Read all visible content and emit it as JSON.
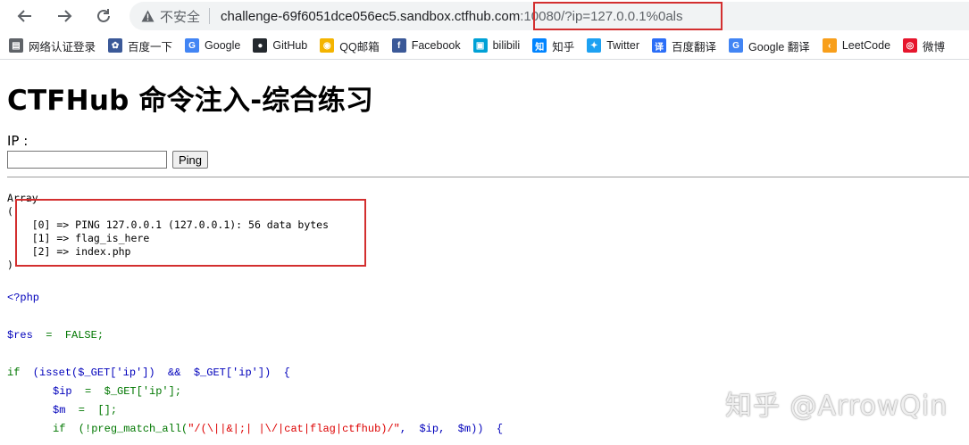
{
  "browser": {
    "insecure_label": "不安全",
    "url_host": "challenge-69f6051dce056ec5.sandbox.ctfhub.com",
    "url_rest": ":10080/?ip=127.0.0.1%0als"
  },
  "bookmarks": [
    {
      "label": "网络认证登录",
      "icon": "doc-icon",
      "color": "#5f6368"
    },
    {
      "label": "百度一下",
      "icon": "baidu-paw-icon",
      "color": "#3b5998"
    },
    {
      "label": "Google",
      "icon": "google-g-icon",
      "color": "#4285f4"
    },
    {
      "label": "GitHub",
      "icon": "github-icon",
      "color": "#24292e"
    },
    {
      "label": "QQ邮箱",
      "icon": "qq-mail-icon",
      "color": "#f4b400"
    },
    {
      "label": "Facebook",
      "icon": "facebook-icon",
      "color": "#3b5998"
    },
    {
      "label": "bilibili",
      "icon": "bilibili-tv-icon",
      "color": "#00a1d6"
    },
    {
      "label": "知乎",
      "icon": "zhihu-icon",
      "color": "#0084ff"
    },
    {
      "label": "Twitter",
      "icon": "twitter-bird-icon",
      "color": "#1da1f2"
    },
    {
      "label": "百度翻译",
      "icon": "baidu-translate-icon",
      "color": "#2b6ef7"
    },
    {
      "label": "Google 翻译",
      "icon": "google-translate-icon",
      "color": "#4285f4"
    },
    {
      "label": "LeetCode",
      "icon": "leetcode-icon",
      "color": "#f89f1b"
    },
    {
      "label": "微博",
      "icon": "weibo-icon",
      "color": "#e6162d"
    }
  ],
  "page": {
    "title": "CTFHub 命令注入-综合练习",
    "ip_label": "IP :",
    "ip_value": "",
    "ping_label": "Ping"
  },
  "output": {
    "array_open": "Array\n(",
    "lines": [
      "    [0] => PING 127.0.0.1 (127.0.0.1): 56 data bytes",
      "    [1] => flag_is_here",
      "    [2] => index.php"
    ],
    "array_close": ")"
  },
  "code": {
    "php_open": "<?php",
    "res_var": "$res",
    "res_rest": "  =  FALSE;",
    "if_kw": "if",
    "if_rest": "  (isset($_GET['ip'])  &&  $_GET['ip'])  {",
    "ip_assign_var": "$ip",
    "ip_assign_rest": "  =  $_GET['ip'];",
    "m_var": "$m",
    "m_rest": "  =  [];",
    "inner_if_kw": "if",
    "inner_if_rest": "  (!preg_match_all(",
    "regex_str": "\"/(\\||&|;| |\\/|cat|flag|ctfhub)/\"",
    "inner_if_tail": ",  $ip,  $m))  {"
  },
  "watermark": "知乎 @ArrowQin"
}
